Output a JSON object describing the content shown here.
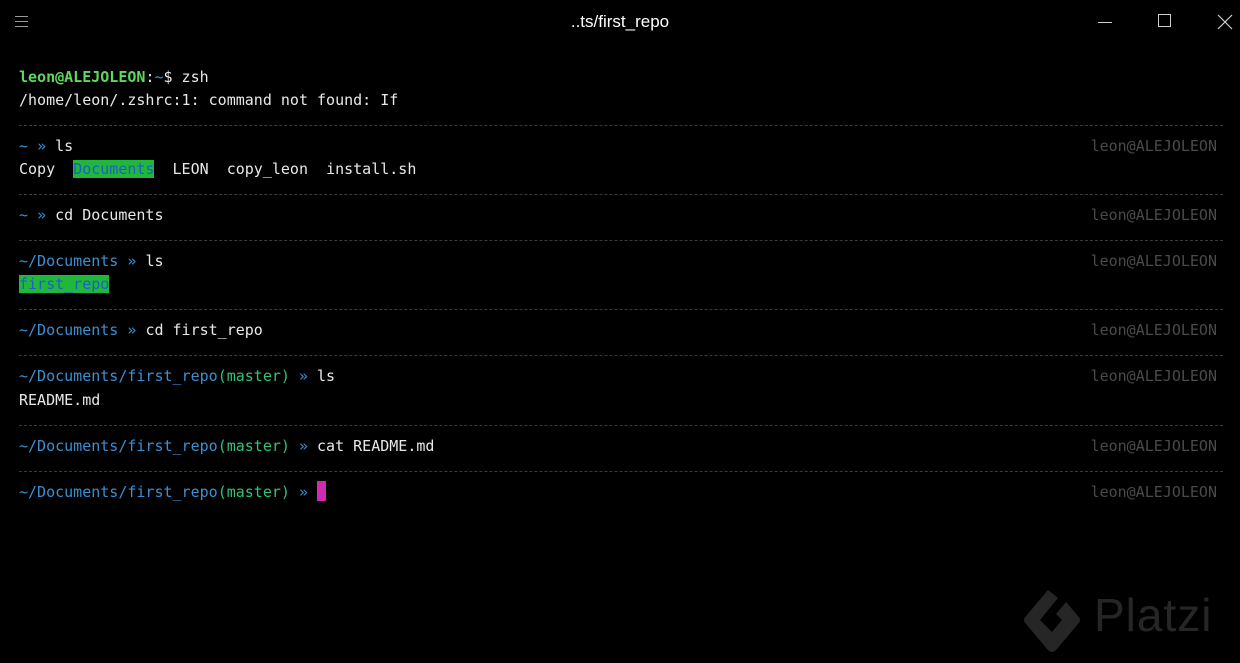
{
  "window": {
    "title": "..ts/first_repo"
  },
  "colors": {
    "background": "#000000",
    "user": "#5fd75f",
    "path": "#3b8fd0",
    "branch": "#32c27a",
    "cursor": "#d02ab0",
    "dir_highlight": "#1fb83a",
    "right_tag": "#4a4a4a"
  },
  "icons": {
    "menu": "hamburger-icon",
    "minimize": "minimize-icon",
    "maximize": "maximize-icon",
    "close": "close-icon",
    "watermark": "platzi-logo"
  },
  "terminal": {
    "first": {
      "user": "leon@ALEJOLEON",
      "colon": ":",
      "tilde": "~",
      "dollar": "$",
      "command": " zsh"
    },
    "error": "/home/leon/.zshrc:1: command not found: If",
    "right_tag": "leon@ALEJOLEON",
    "blocks": [
      {
        "path": "~",
        "arrow": "»",
        "command": "ls",
        "output": [
          "Copy",
          "Documents",
          "LEON",
          "copy_leon",
          "install.sh"
        ]
      },
      {
        "path": "~",
        "arrow": "»",
        "command": "cd Documents"
      },
      {
        "path": "~/Documents",
        "arrow": "»",
        "command": "ls",
        "output": [
          "first_repo"
        ]
      },
      {
        "path": "~/Documents",
        "arrow": "»",
        "command": "cd first_repo"
      },
      {
        "path": "~/Documents/first_repo",
        "branch": "(master)",
        "arrow": "»",
        "command": "ls",
        "output": [
          "README.md"
        ]
      },
      {
        "path": "~/Documents/first_repo",
        "branch": "(master)",
        "arrow": "»",
        "command": "cat README.md"
      },
      {
        "path": "~/Documents/first_repo",
        "branch": "(master)",
        "arrow": "»",
        "command": ""
      }
    ]
  },
  "watermark": {
    "text": "Platzi"
  }
}
